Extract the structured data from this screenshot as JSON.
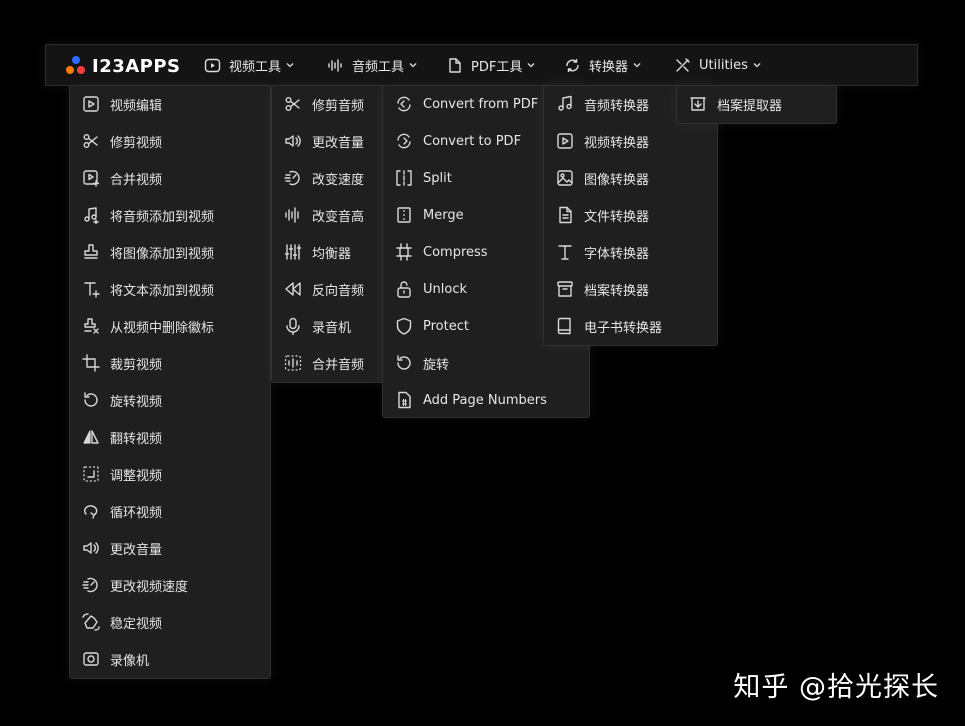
{
  "logo": {
    "text": "I23APPS",
    "dot_colors": [
      "#ff7a00",
      "#2f6bff",
      "#ff3d3d"
    ]
  },
  "nav": [
    {
      "label": "视频工具",
      "icon": "play-circle-icon"
    },
    {
      "label": "音频工具",
      "icon": "audio-wave-icon"
    },
    {
      "label": "PDF工具",
      "icon": "file-icon"
    },
    {
      "label": "转换器",
      "icon": "refresh-icon"
    },
    {
      "label": "Utilities",
      "icon": "tools-icon"
    }
  ],
  "video_menu": [
    {
      "label": "视频编辑",
      "icon": "video-edit-icon"
    },
    {
      "label": "修剪视频",
      "icon": "scissors-icon"
    },
    {
      "label": "合并视频",
      "icon": "video-add-icon"
    },
    {
      "label": "将音频添加到视频",
      "icon": "music-plus-icon"
    },
    {
      "label": "将图像添加到视频",
      "icon": "stamp-icon"
    },
    {
      "label": "将文本添加到视频",
      "icon": "text-plus-icon"
    },
    {
      "label": "从视频中删除徽标",
      "icon": "stamp-remove-icon"
    },
    {
      "label": "裁剪视频",
      "icon": "crop-icon"
    },
    {
      "label": "旋转视频",
      "icon": "rotate-icon"
    },
    {
      "label": "翻转视频",
      "icon": "flip-icon"
    },
    {
      "label": "调整视频",
      "icon": "resize-icon"
    },
    {
      "label": "循环视频",
      "icon": "loop-icon"
    },
    {
      "label": "更改音量",
      "icon": "volume-icon"
    },
    {
      "label": "更改视频速度",
      "icon": "speed-icon"
    },
    {
      "label": "稳定视频",
      "icon": "stabilize-icon"
    },
    {
      "label": "录像机",
      "icon": "camera-icon"
    }
  ],
  "audio_menu": [
    {
      "label": "修剪音频",
      "icon": "scissors-icon"
    },
    {
      "label": "更改音量",
      "icon": "volume-icon"
    },
    {
      "label": "改变速度",
      "icon": "speed-icon"
    },
    {
      "label": "改变音高",
      "icon": "audio-wave-icon"
    },
    {
      "label": "均衡器",
      "icon": "equalizer-icon"
    },
    {
      "label": "反向音频",
      "icon": "rewind-icon"
    },
    {
      "label": "录音机",
      "icon": "microphone-icon"
    },
    {
      "label": "合并音频",
      "icon": "merge-audio-icon"
    }
  ],
  "pdf_menu": [
    {
      "label": "Convert from PDF",
      "icon": "convert-from-icon"
    },
    {
      "label": "Convert to PDF",
      "icon": "convert-to-icon"
    },
    {
      "label": "Split",
      "icon": "split-icon"
    },
    {
      "label": "Merge",
      "icon": "merge-icon"
    },
    {
      "label": "Compress",
      "icon": "compress-icon"
    },
    {
      "label": "Unlock",
      "icon": "unlock-icon"
    },
    {
      "label": "Protect",
      "icon": "shield-icon"
    },
    {
      "label": "旋转",
      "icon": "rotate-icon"
    },
    {
      "label": "Add Page Numbers",
      "icon": "page-number-icon"
    }
  ],
  "converter_menu": [
    {
      "label": "音频转换器",
      "icon": "music-note-icon"
    },
    {
      "label": "视频转换器",
      "icon": "video-icon"
    },
    {
      "label": "图像转换器",
      "icon": "image-icon"
    },
    {
      "label": "文件转换器",
      "icon": "document-icon"
    },
    {
      "label": "字体转换器",
      "icon": "font-icon"
    },
    {
      "label": "档案转换器",
      "icon": "archive-icon"
    },
    {
      "label": "电子书转换器",
      "icon": "ebook-icon"
    }
  ],
  "utilities_menu": [
    {
      "label": "档案提取器",
      "icon": "archive-extract-icon"
    }
  ],
  "watermark": "知乎 @拾光探长"
}
